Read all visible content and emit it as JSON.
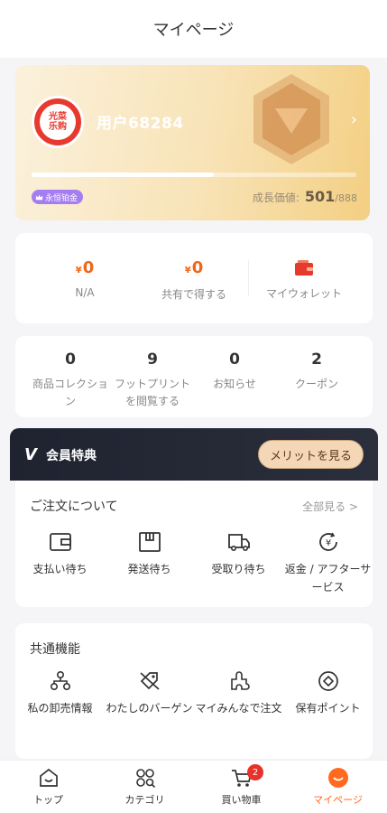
{
  "header": {
    "title": "マイページ"
  },
  "profile": {
    "username": "用户68284",
    "avatar_text_top": "光菜",
    "avatar_text_bottom": "乐购",
    "level_tag": "永恒铂金",
    "growth_label": "成長価値:",
    "growth_current": "501",
    "growth_max": "/888",
    "growth_progress": 0.56
  },
  "wallet": {
    "items": [
      {
        "currency": "¥",
        "amount": "0",
        "label": "N/A"
      },
      {
        "currency": "¥",
        "amount": "0",
        "label": "共有で得する"
      },
      {
        "label": "マイウォレット",
        "icon": "wallet-icon"
      }
    ]
  },
  "stats": [
    {
      "count": "0",
      "label": "商品コレクション"
    },
    {
      "count": "9",
      "label": "フットプリントを閲覧する"
    },
    {
      "count": "0",
      "label": "お知らせ"
    },
    {
      "count": "2",
      "label": "クーポン"
    }
  ],
  "member": {
    "logo": "V",
    "title": "会員特典",
    "button": "メリットを見る"
  },
  "orders": {
    "title": "ご注文について",
    "see_all": "全部見る >",
    "items": [
      {
        "label": "支払い待ち",
        "icon": "payment-icon"
      },
      {
        "label": "発送待ち",
        "icon": "package-icon"
      },
      {
        "label": "受取り待ち",
        "icon": "truck-icon"
      },
      {
        "label": "返金 / アフターサービス",
        "icon": "refund-icon"
      }
    ]
  },
  "common": {
    "title": "共通機能",
    "items": [
      {
        "label": "私の卸売情報",
        "icon": "wholesale-icon"
      },
      {
        "label": "わたしのバーゲン",
        "icon": "bargain-icon"
      },
      {
        "label": "マイみんなで注文",
        "icon": "group-order-icon"
      },
      {
        "label": "保有ポイント",
        "icon": "points-icon"
      }
    ]
  },
  "tabbar": {
    "items": [
      {
        "label": "トップ",
        "icon": "home-icon"
      },
      {
        "label": "カテゴリ",
        "icon": "category-icon"
      },
      {
        "label": "買い物車",
        "icon": "cart-icon",
        "badge": "2"
      },
      {
        "label": "マイページ",
        "icon": "profile-icon",
        "active": true
      }
    ]
  },
  "colors": {
    "accent": "#ff6a1f",
    "badge": "#e8312a",
    "price": "#f0661a"
  }
}
